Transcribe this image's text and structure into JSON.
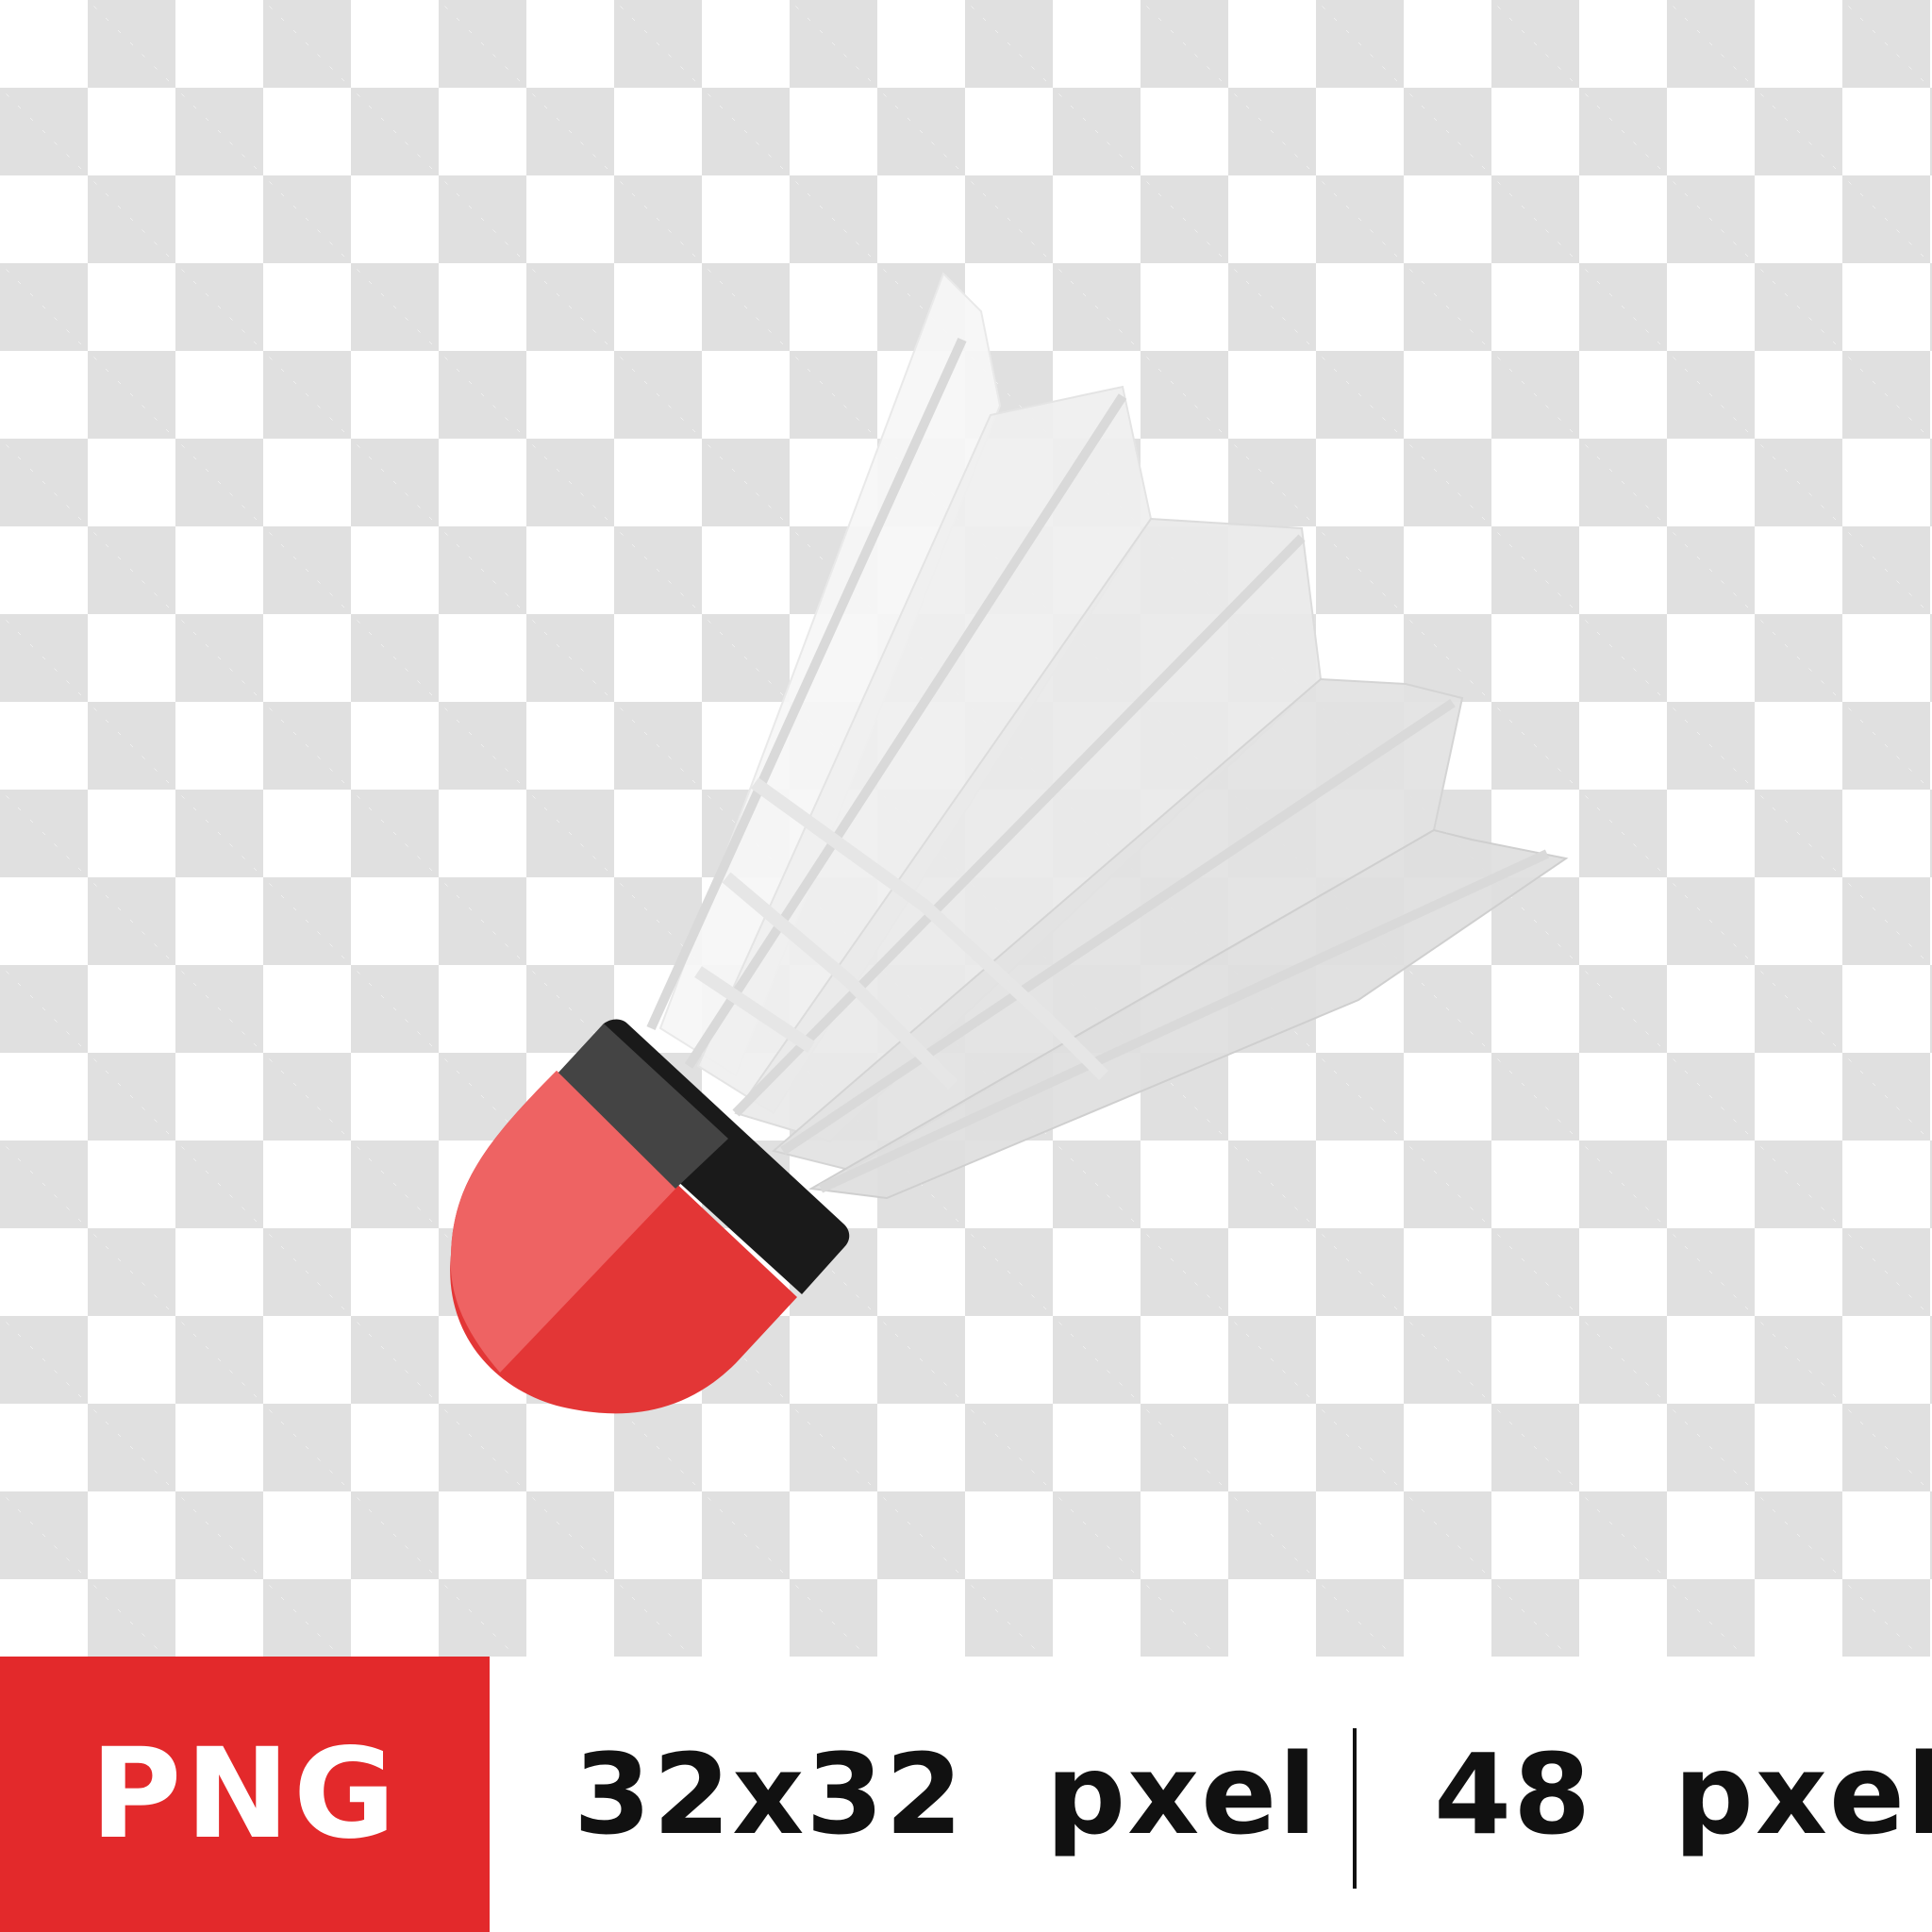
{
  "preview": {
    "subject": "shuttlecock",
    "background": "transparency-checkerboard",
    "colors": {
      "cork_red": "#e33636",
      "cork_red_light": "#ee6363",
      "band_black": "#1a1a1a",
      "feather_white": "#f4f4f4",
      "checker_gray": "#e0e0e0"
    }
  },
  "footer": {
    "format_label": "PNG",
    "format_color": "#e3292b",
    "size_primary": "32x32  pxel",
    "size_secondary": "48  pxel"
  }
}
